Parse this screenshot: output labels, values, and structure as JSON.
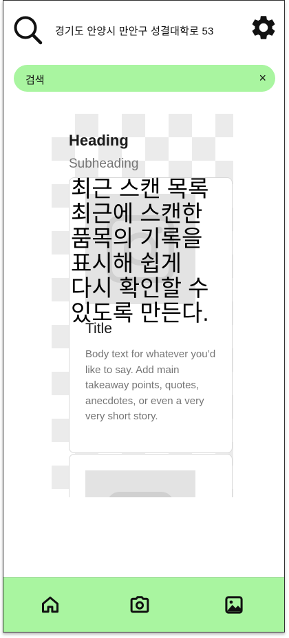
{
  "header": {
    "address": "경기도 안양시 만안구 성결대학로 53",
    "search_icon": "search-icon",
    "settings_icon": "gear-icon"
  },
  "search_bar": {
    "label": "검색",
    "close_label": "×"
  },
  "content": {
    "heading": "Heading",
    "subheading": "Subheading",
    "overlay_text": "최근 스캔 목록 최근에 스캔한 품목의 기록을 표시해 쉽게 다시 확인할 수 있도록 만든다.",
    "cards": [
      {
        "title": "Title",
        "body": "Body text for whatever you’d like to say. Add main takeaway points, quotes, anecdotes, or even a very very short story.",
        "image_icon": "image-placeholder-icon"
      },
      {
        "image_icon": "image-placeholder-icon"
      }
    ]
  },
  "bottom_nav": {
    "items": [
      {
        "icon": "home-icon"
      },
      {
        "icon": "camera-icon"
      },
      {
        "icon": "gallery-icon"
      }
    ]
  },
  "colors": {
    "accent": "#a9f5a0"
  }
}
